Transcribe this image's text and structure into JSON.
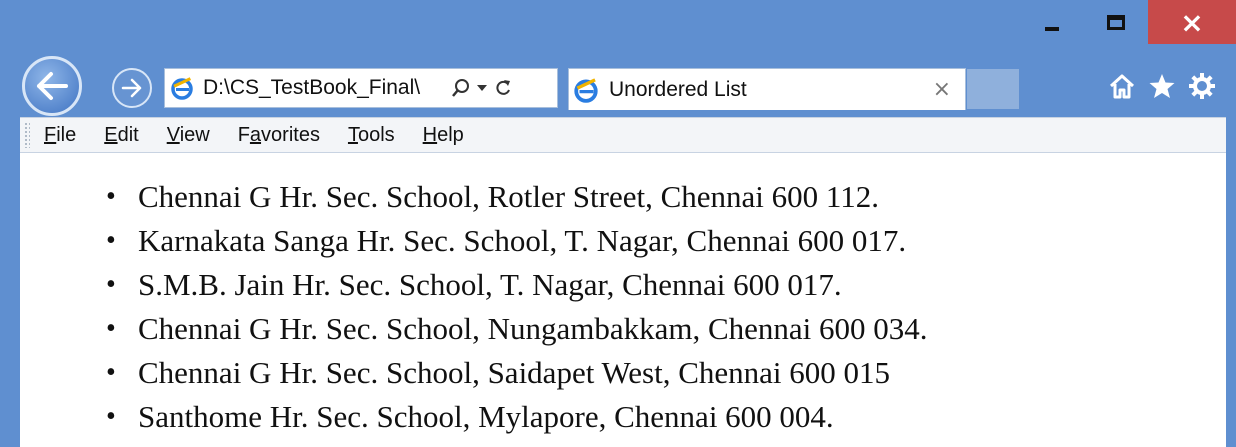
{
  "window": {
    "controls": {
      "minimize": "",
      "maximize": "",
      "close": "×"
    }
  },
  "nav": {
    "address": "D:\\CS_TestBook_Final\\",
    "tab_title": "Unordered List",
    "tab_close": "×"
  },
  "icons": {
    "back": "back-arrow-icon",
    "forward": "forward-arrow-icon",
    "ie": "internet-explorer-icon",
    "search": "search-icon",
    "dropdown": "chevron-down-icon",
    "refresh": "refresh-icon",
    "home": "home-icon",
    "favorites": "star-icon",
    "settings": "gear-icon"
  },
  "menu": {
    "items": [
      {
        "accel": "F",
        "rest": "ile"
      },
      {
        "accel": "E",
        "rest": "dit"
      },
      {
        "accel": "V",
        "rest": "iew"
      },
      {
        "pre": "F",
        "accel": "a",
        "rest": "vorites"
      },
      {
        "accel": "T",
        "rest": "ools"
      },
      {
        "accel": "H",
        "rest": "elp"
      }
    ]
  },
  "content": {
    "items": [
      "Chennai G Hr. Sec. School, Rotler Street, Chennai 600 112.",
      "Karnakata Sanga Hr. Sec. School, T. Nagar, Chennai 600 017.",
      "S.M.B. Jain Hr. Sec. School, T. Nagar, Chennai 600 017.",
      "Chennai G Hr. Sec. School, Nungambakkam, Chennai 600 034.",
      "Chennai G Hr. Sec. School, Saidapet West, Chennai 600 015",
      "Santhome Hr. Sec. School, Mylapore, Chennai 600 004."
    ]
  },
  "colors": {
    "frame": "#5f8fd0",
    "close_button": "#c74a4a",
    "menubar": "#f3f5f8"
  }
}
